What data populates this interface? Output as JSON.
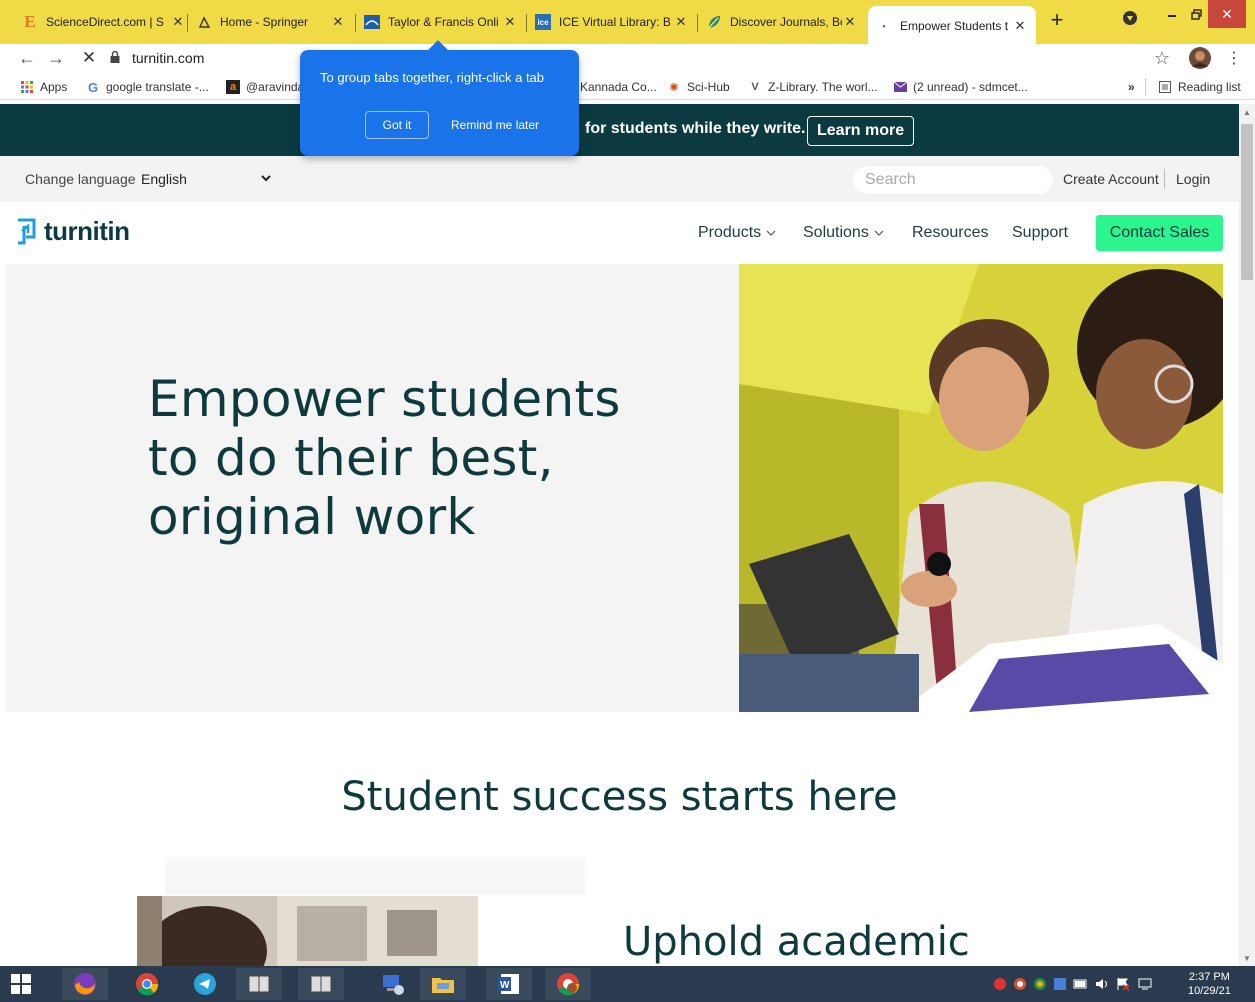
{
  "browser": {
    "tabs": [
      {
        "title": "ScienceDirect.com | S",
        "favicon": "E",
        "color": "#e87722"
      },
      {
        "title": "Home - Springer",
        "favicon": "springer-icon",
        "color": "#333"
      },
      {
        "title": "Taylor & Francis Onli",
        "favicon": "tf-icon",
        "color": "#1e5fa8"
      },
      {
        "title": "ICE Virtual Library: B",
        "favicon": "ice",
        "color": "#2a6ebb"
      },
      {
        "title": "Discover Journals, Bo",
        "favicon": "leaf-icon",
        "color": "#2e8b57"
      },
      {
        "title": "Empower Students t",
        "favicon": "loading-icon",
        "active": true
      }
    ],
    "new_tab": "+",
    "url": "turnitin.com",
    "bookmarks": [
      {
        "label": "Apps"
      },
      {
        "label": "google translate -..."
      },
      {
        "label": "@aravinda"
      },
      {
        "label": "Kannada Co..."
      },
      {
        "label": "Sci-Hub"
      },
      {
        "label": "Z-Library. The worl..."
      },
      {
        "label": "(2 unread) - sdmcet..."
      }
    ],
    "more_bookmarks": "»",
    "reading_list": "Reading list"
  },
  "popup": {
    "text": "To group tabs together, right-click a tab",
    "got_it": "Got it",
    "remind": "Remind me later"
  },
  "site": {
    "banner_text": "for students while they write.",
    "banner_button": "Learn more",
    "change_language_label": "Change language",
    "language": "English",
    "search_placeholder": "Search",
    "create_account": "Create Account",
    "login": "Login",
    "logo_text": "turnitin",
    "nav": {
      "products": "Products",
      "solutions": "Solutions",
      "resources": "Resources",
      "support": "Support",
      "contact": "Contact Sales"
    },
    "hero_title_1": "Empower students",
    "hero_title_2": "to do their best,",
    "hero_title_3": "original work",
    "section_title": "Student success starts here",
    "subsection_title": "Uphold academic"
  },
  "taskbar": {
    "time": "2:37 PM",
    "date": "10/29/21"
  },
  "colors": {
    "tabstrip": "#f0db47",
    "banner": "#0b3b40",
    "accent_green": "#2cf58e",
    "popup_blue": "#1a73e8",
    "taskbar": "#2a3b50"
  }
}
